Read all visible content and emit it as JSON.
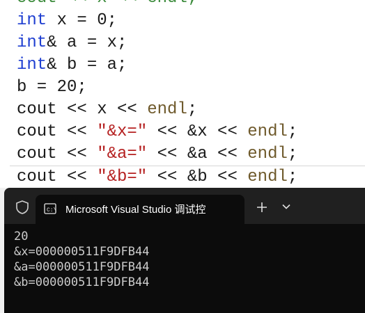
{
  "editor": {
    "lines": [
      {
        "tokens": [
          {
            "t": "cout << x << endl;",
            "c": "cmt"
          }
        ],
        "partial": true
      },
      {
        "tokens": [
          {
            "t": "int",
            "c": "kw"
          },
          {
            "t": " x = 0;",
            "c": "ident"
          }
        ]
      },
      {
        "tokens": [
          {
            "t": "int",
            "c": "kw"
          },
          {
            "t": "& a = x;",
            "c": "ident"
          }
        ]
      },
      {
        "tokens": [
          {
            "t": "int",
            "c": "kw"
          },
          {
            "t": "& b = a;",
            "c": "ident"
          }
        ]
      },
      {
        "tokens": [
          {
            "t": "b = 20;",
            "c": "ident"
          }
        ]
      },
      {
        "tokens": [
          {
            "t": "cout << x << ",
            "c": "ident"
          },
          {
            "t": "endl",
            "c": "endl"
          },
          {
            "t": ";",
            "c": "ident"
          }
        ]
      },
      {
        "tokens": [
          {
            "t": "cout << ",
            "c": "ident"
          },
          {
            "t": "\"&x=\"",
            "c": "str"
          },
          {
            "t": " << &x << ",
            "c": "ident"
          },
          {
            "t": "endl",
            "c": "endl"
          },
          {
            "t": ";",
            "c": "ident"
          }
        ]
      },
      {
        "tokens": [
          {
            "t": "cout << ",
            "c": "ident"
          },
          {
            "t": "\"&a=\"",
            "c": "str"
          },
          {
            "t": " << &a << ",
            "c": "ident"
          },
          {
            "t": "endl",
            "c": "endl"
          },
          {
            "t": ";",
            "c": "ident"
          }
        ]
      },
      {
        "tokens": [
          {
            "t": "cout << ",
            "c": "ident"
          },
          {
            "t": "\"&b=\"",
            "c": "str"
          },
          {
            "t": " << &b << ",
            "c": "ident"
          },
          {
            "t": "endl",
            "c": "endl"
          },
          {
            "t": ";",
            "c": "ident"
          }
        ],
        "current": true
      }
    ]
  },
  "terminal": {
    "tab_title": "Microsoft Visual Studio 调试控",
    "new_tab_icon": "plus-icon",
    "dropdown_icon": "chevron-down-icon",
    "output": [
      "20",
      "&x=000000511F9DFB44",
      "&a=000000511F9DFB44",
      "&b=000000511F9DFB44"
    ]
  },
  "colors": {
    "keyword": "#1f3fd1",
    "string": "#b52020",
    "endl": "#6f5a2c",
    "comment": "#3d8c3d",
    "terminal_bg": "#0c0c0c",
    "tabbar_bg": "#202020"
  }
}
